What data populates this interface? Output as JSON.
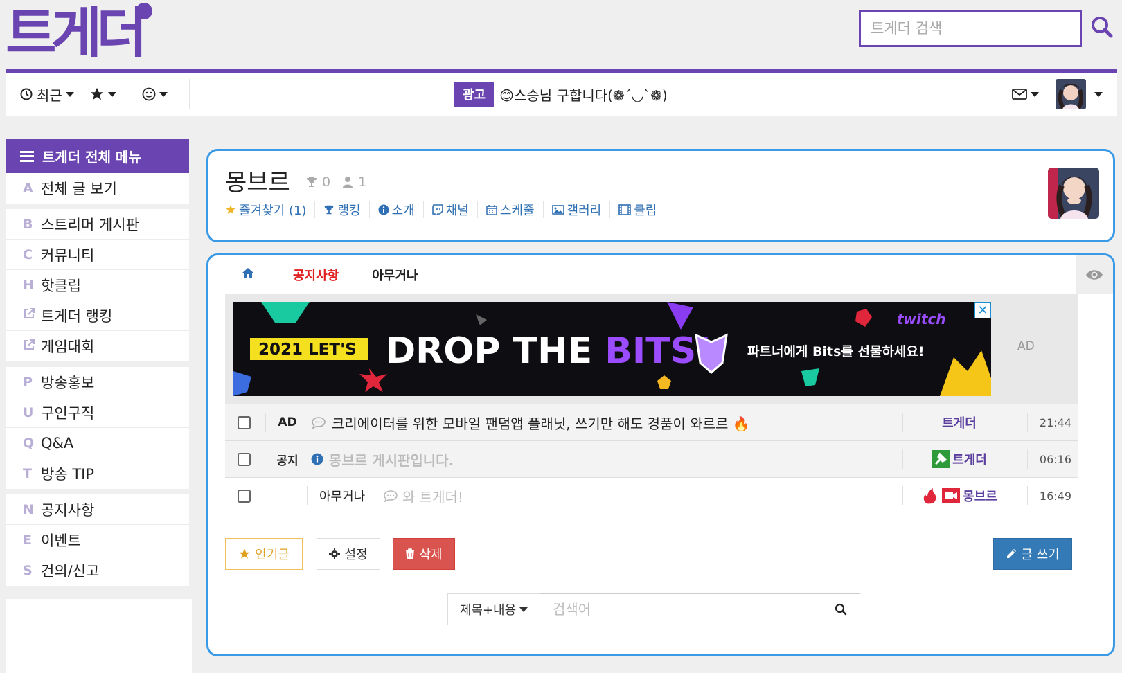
{
  "header": {
    "logo_text": "트게더",
    "search_placeholder": "트게더 검색"
  },
  "topnav": {
    "recent_label": "최근",
    "ad_label": "광고",
    "ad_text": "😊스승님 구합니다(❁´◡`❁)"
  },
  "sidebar": {
    "title": "트게더 전체 메뉴",
    "groups": [
      [
        {
          "key": "A",
          "label": "전체 글 보기"
        }
      ],
      [
        {
          "key": "B",
          "label": "스트리머 게시판"
        },
        {
          "key": "C",
          "label": "커뮤니티"
        },
        {
          "key": "H",
          "label": "핫클립"
        },
        {
          "key": "",
          "label": "트게더 랭킹"
        },
        {
          "key": "",
          "label": "게임대회"
        }
      ],
      [
        {
          "key": "P",
          "label": "방송홍보"
        },
        {
          "key": "U",
          "label": "구인구직"
        },
        {
          "key": "Q",
          "label": "Q&A"
        },
        {
          "key": "T",
          "label": "방송 TIP"
        }
      ],
      [
        {
          "key": "N",
          "label": "공지사항"
        },
        {
          "key": "E",
          "label": "이벤트"
        },
        {
          "key": "S",
          "label": "건의/신고"
        }
      ]
    ]
  },
  "board": {
    "title": "몽브르",
    "trophies": "0",
    "members": "1",
    "links": [
      "즐겨찾기 (1)",
      "랭킹",
      "소개",
      "채널",
      "스케줄",
      "갤러리",
      "클립"
    ]
  },
  "tabs": [
    "공지사항",
    "아무거나"
  ],
  "ad_banner": {
    "tag": "2021 LET'S",
    "headline_a": "DROP THE ",
    "headline_b": "BITS!",
    "sub": "파트너에게 Bits를 선물하세요!",
    "brand": "twitch",
    "label": "AD"
  },
  "posts": [
    {
      "category": "AD",
      "title": "크리에이터를 위한 모바일 팬덤앱 플래닛, 쓰기만 해도 경품이 와르르 🔥",
      "author": "트게더",
      "time": "21:44"
    },
    {
      "category": "공지",
      "title": "몽브르 게시판입니다.",
      "author": "트게더",
      "time": "06:16"
    },
    {
      "category": "",
      "subcat": "아무거나",
      "title": "와 트게더!",
      "author": "몽브르",
      "time": "16:49"
    }
  ],
  "buttons": {
    "popular": "인기글",
    "settings": "설정",
    "delete": "삭제",
    "write": "글 쓰기"
  },
  "board_search": {
    "select": "제목+내용",
    "placeholder": "검색어"
  },
  "colors": {
    "brand_purple": "#6a44b0",
    "accent_blue": "#3a9ae6",
    "delete_red": "#d9534f",
    "write_blue": "#337ab7"
  }
}
